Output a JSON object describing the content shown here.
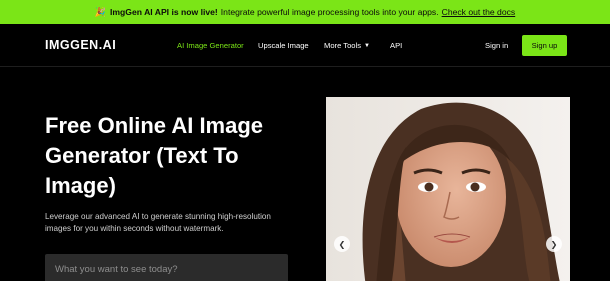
{
  "banner": {
    "emoji": "🎉",
    "bold_text": "ImgGen AI API is now live!",
    "text": "Integrate powerful image processing tools into your apps.",
    "link_text": "Check out the docs"
  },
  "nav": {
    "logo": "IMGGEN.AI",
    "links": [
      {
        "label": "AI Image Generator"
      },
      {
        "label": "Upscale Image"
      },
      {
        "label": "More Tools"
      },
      {
        "label": "API"
      }
    ],
    "signin": "Sign in",
    "signup": "Sign up"
  },
  "hero": {
    "title": "Free Online AI Image Generator (Text To Image)",
    "subtitle": "Leverage our advanced AI to generate stunning high-resolution images for you within seconds without watermark.",
    "input_placeholder": "What you want to see today?"
  },
  "carousel": {
    "prev_icon": "chevron-left-icon",
    "next_icon": "chevron-right-icon"
  },
  "colors": {
    "accent": "#7be517",
    "background": "#000000",
    "input_bg": "#2b2b2b"
  }
}
